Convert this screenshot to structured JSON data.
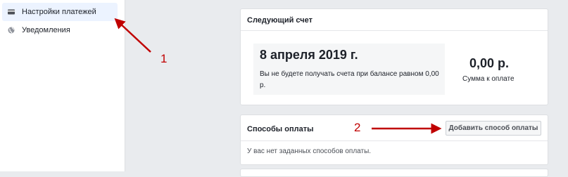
{
  "sidebar": {
    "items": [
      {
        "label": "Настройки платежей",
        "icon": "credit-card-icon",
        "active": true
      },
      {
        "label": "Уведомления",
        "icon": "globe-icon",
        "active": false
      }
    ]
  },
  "next_bill": {
    "title": "Следующий счет",
    "date": "8 апреля 2019 г.",
    "description": "Вы не будете получать счета при балансе равном 0,00 р.",
    "amount": "0,00 р.",
    "amount_label": "Сумма к оплате"
  },
  "payment_methods": {
    "title": "Способы оплаты",
    "add_button": "Добавить способ оплаты",
    "empty_text": "У вас нет заданных способов оплаты."
  },
  "annotations": {
    "marker_1": "1",
    "marker_2": "2",
    "arrow_color": "#c00000"
  },
  "colors": {
    "background": "#e9ebee",
    "active_nav": "#ecf3ff",
    "card": "#ffffff"
  }
}
